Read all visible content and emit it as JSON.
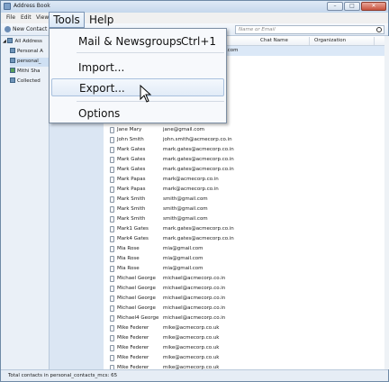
{
  "window": {
    "title": "Address Book"
  },
  "menubar": {
    "file": "File",
    "edit": "Edit",
    "view": "View",
    "tools": "Tools",
    "help": "Help"
  },
  "toolbar": {
    "new_contact": "New Contact",
    "search_placeholder": "Name or Email"
  },
  "sidebar": {
    "items": [
      "All Address",
      "Personal A",
      "personal_",
      "Mithi Sha",
      "Collected"
    ]
  },
  "columns": {
    "chat": "Chat Name",
    "org": "Organization"
  },
  "tools_menu": {
    "items": [
      {
        "label": "Mail & Newsgroups",
        "shortcut": "Ctrl+1"
      },
      {
        "label": "Import..."
      },
      {
        "label": "Export..."
      },
      {
        "label": "Options"
      }
    ]
  },
  "contacts": [
    {
      "name": "",
      "email": ".com"
    },
    {
      "name": "",
      "email": ""
    },
    {
      "name": "",
      "email": ""
    },
    {
      "name": "",
      "email": ""
    },
    {
      "name": "",
      "email": ""
    },
    {
      "name": "",
      "email": ""
    },
    {
      "name": "",
      "email": ""
    },
    {
      "name": "",
      "email": ""
    },
    {
      "name": "Jane Mary",
      "email": "jane@gmail.com"
    },
    {
      "name": "John Smith",
      "email": "john.smith@acmecorp.co.in"
    },
    {
      "name": "Mark Gates",
      "email": "mark.gates@acmecorp.co.in"
    },
    {
      "name": "Mark Gates",
      "email": "mark.gates@acmecorp.co.in"
    },
    {
      "name": "Mark Gates",
      "email": "mark.gates@acmecorp.co.in"
    },
    {
      "name": "Mark Papas",
      "email": "mark@acmecorp.co.in"
    },
    {
      "name": "Mark Papas",
      "email": "mark@acmecorp.co.in"
    },
    {
      "name": "Mark Smith",
      "email": "smith@gmail.com"
    },
    {
      "name": "Mark Smith",
      "email": "smith@gmail.com"
    },
    {
      "name": "Mark Smith",
      "email": "smith@gmail.com"
    },
    {
      "name": "Mark1 Gates",
      "email": "mark.gates@acmecorp.co.in"
    },
    {
      "name": "Mark4 Gates",
      "email": "mark.gates@acmecorp.co.in"
    },
    {
      "name": "Mia Rose",
      "email": "mia@gmail.com"
    },
    {
      "name": "Mia Rose",
      "email": "mia@gmail.com"
    },
    {
      "name": "Mia Rose",
      "email": "mia@gmail.com"
    },
    {
      "name": "Michael George",
      "email": "michael@acmecorp.co.in"
    },
    {
      "name": "Michael George",
      "email": "michael@acmecorp.co.in"
    },
    {
      "name": "Michael George",
      "email": "michael@acmecorp.co.in"
    },
    {
      "name": "Michael George",
      "email": "michael@acmecorp.co.in"
    },
    {
      "name": "Michael4 George",
      "email": "michael@acmecorp.co.in"
    },
    {
      "name": "Mike Federer",
      "email": "mike@acmecorp.co.uk"
    },
    {
      "name": "Mike Federer",
      "email": "mike@acmecorp.co.uk"
    },
    {
      "name": "Mike Federer",
      "email": "mike@acmecorp.co.uk"
    },
    {
      "name": "Mike Federer",
      "email": "mike@acmecorp.co.uk"
    },
    {
      "name": "Mike Federer",
      "email": "mike@acmecorp.co.uk"
    }
  ],
  "status": {
    "text": "Total contacts in personal_contacts_mcs: 65"
  }
}
